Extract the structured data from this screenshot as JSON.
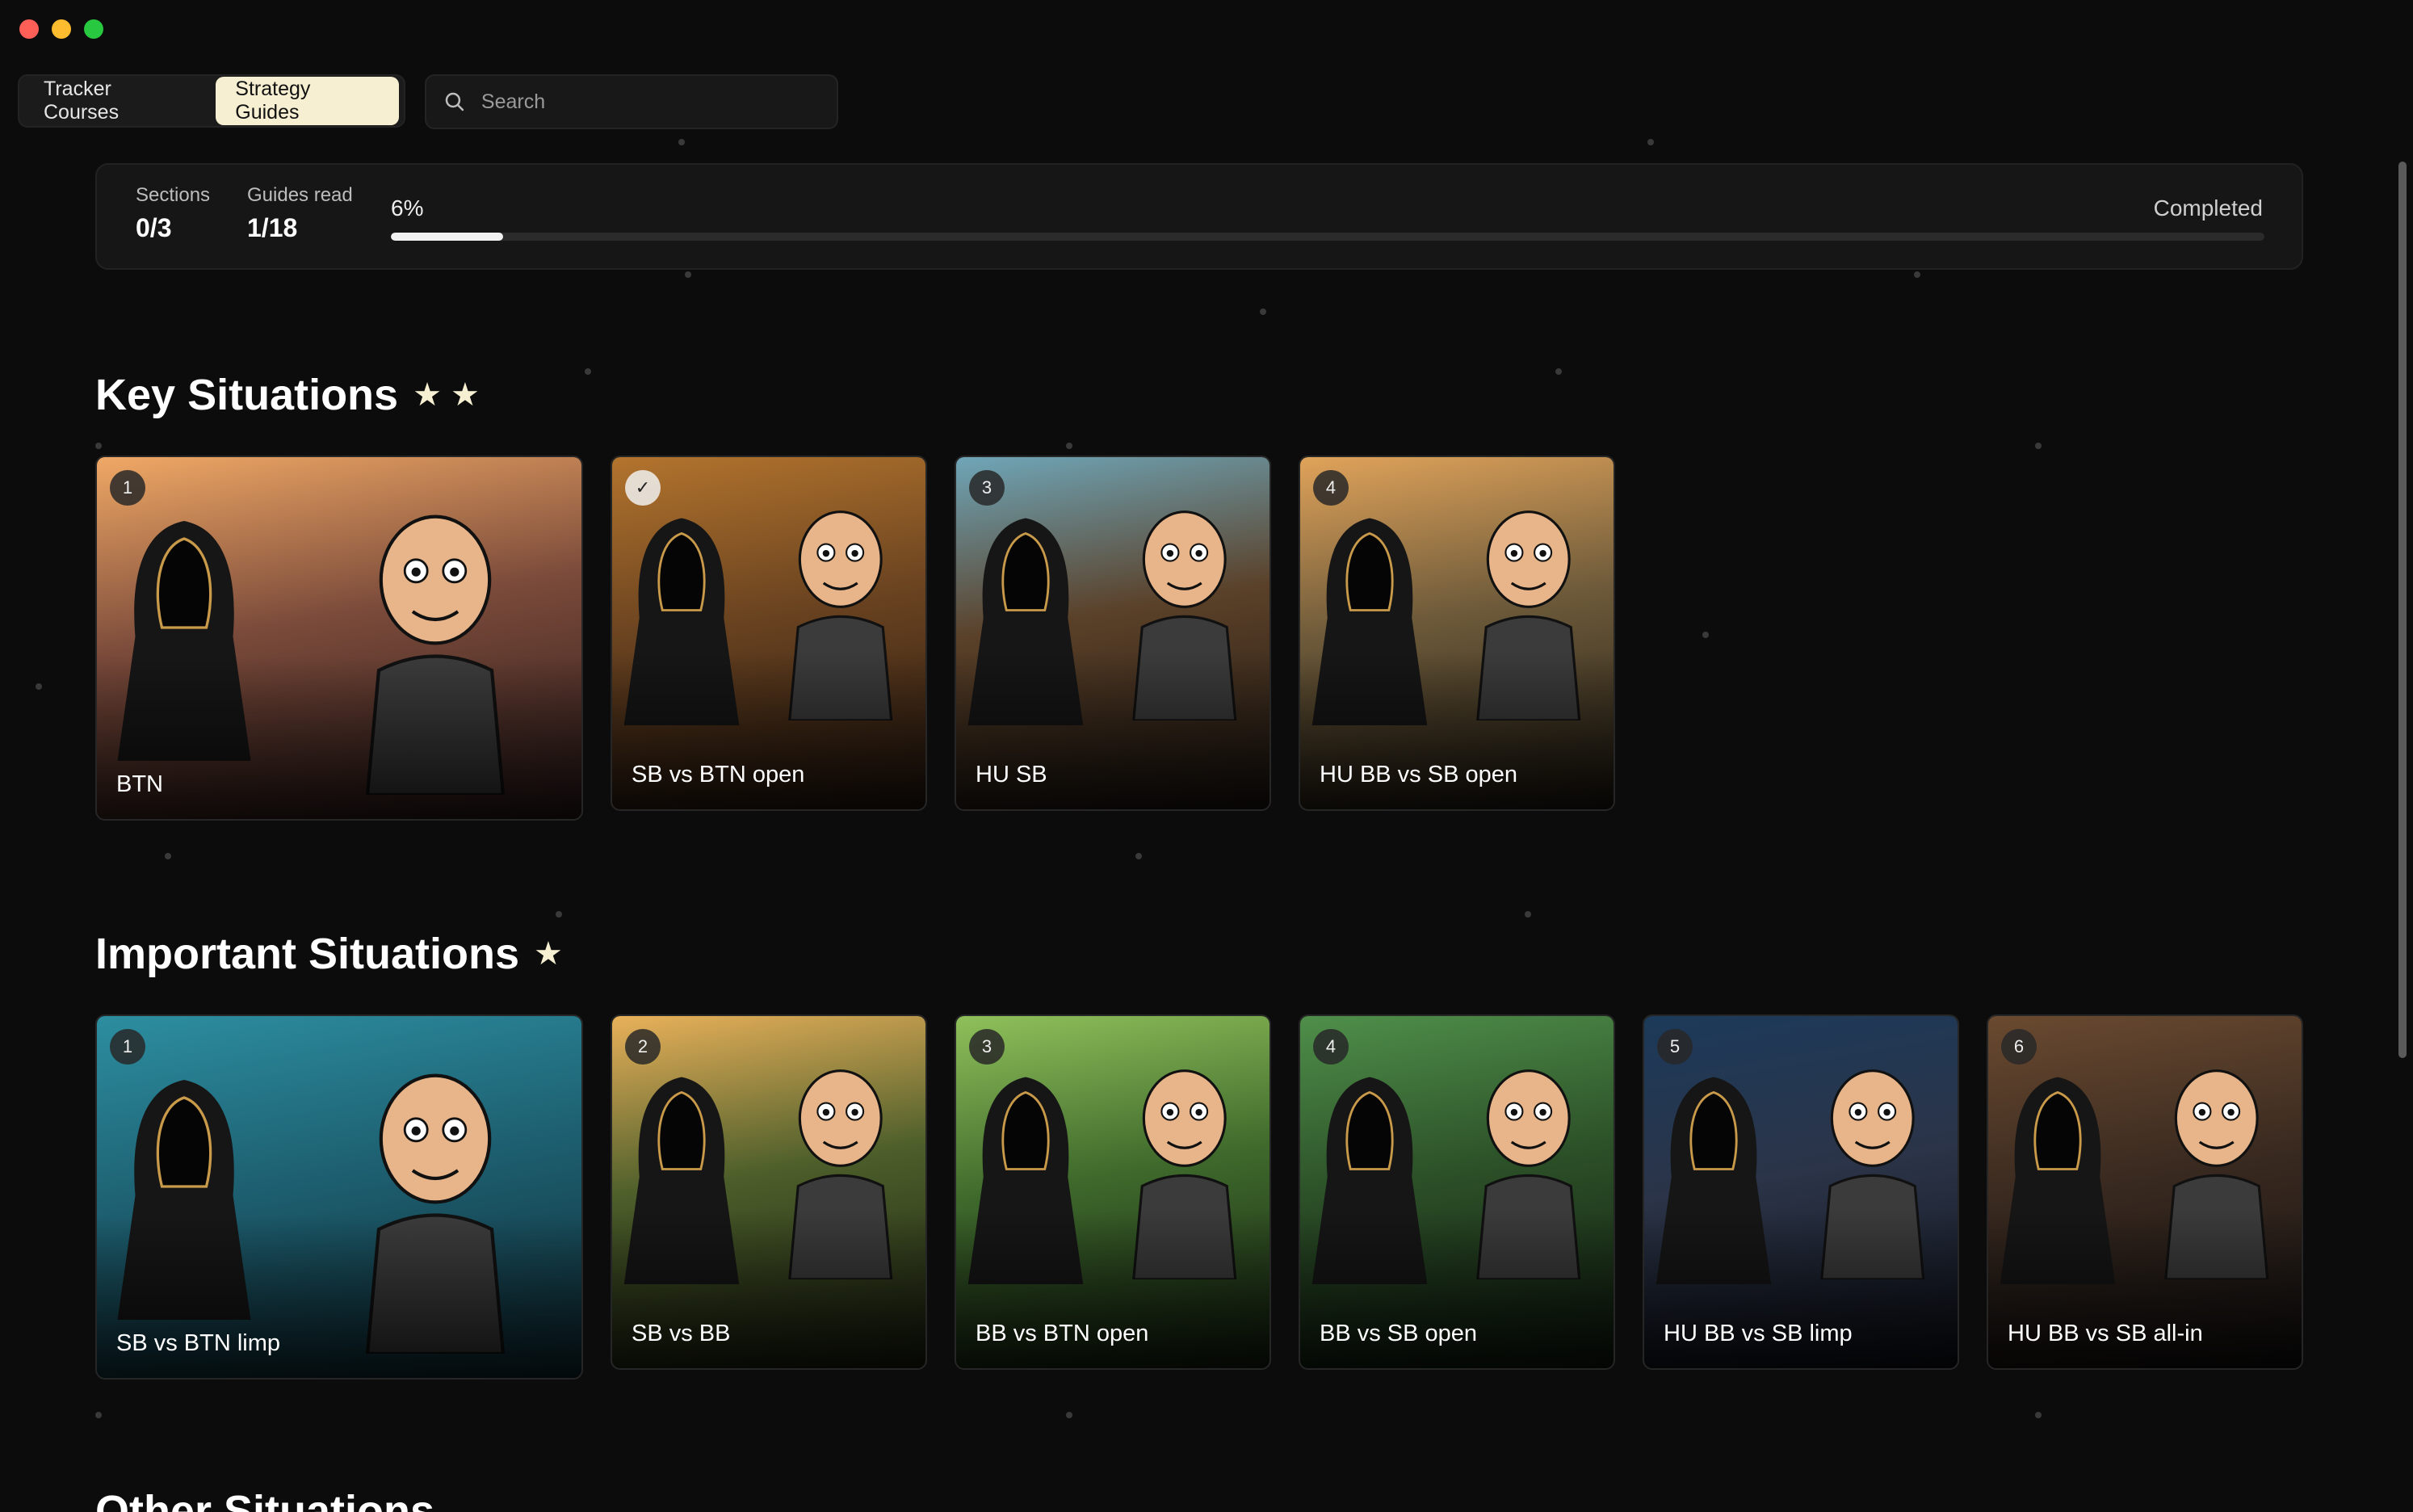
{
  "tabs": [
    {
      "label": "Tracker Courses",
      "active": false
    },
    {
      "label": "Strategy Guides",
      "active": true
    }
  ],
  "search": {
    "placeholder": "Search"
  },
  "stats": {
    "sections_label": "Sections",
    "sections_value": "0/3",
    "guides_label": "Guides read",
    "guides_value": "1/18",
    "percent_text": "6%",
    "progress": 0.06,
    "completed_label": "Completed"
  },
  "key_section": {
    "title": "Key Situations",
    "stars": "★ ★",
    "cards": [
      {
        "badge": "1",
        "title": "BTN",
        "palette": [
          "#f0a865",
          "#7a4a3a",
          "#2a1a1a"
        ]
      },
      {
        "badge": "✓",
        "title": "SB vs BTN open",
        "palette": [
          "#b3742d",
          "#6a4320",
          "#261810"
        ]
      },
      {
        "badge": "3",
        "title": "HU SB",
        "palette": [
          "#6fa6b8",
          "#5a4028",
          "#1e1712"
        ]
      },
      {
        "badge": "4",
        "title": "HU BB vs SB open",
        "palette": [
          "#e0a35a",
          "#6d5a3a",
          "#1f1a12"
        ]
      }
    ]
  },
  "important_section": {
    "title": "Important Situations",
    "stars": "★",
    "cards": [
      {
        "badge": "1",
        "title": "SB vs BTN limp",
        "palette": [
          "#2c8ea0",
          "#1d5f70",
          "#0f2a33"
        ]
      },
      {
        "badge": "2",
        "title": "SB vs BB",
        "palette": [
          "#e9b15a",
          "#4c5e2a",
          "#1a1f10"
        ]
      },
      {
        "badge": "3",
        "title": "BB vs BTN open",
        "palette": [
          "#8fc05a",
          "#3f6a2c",
          "#142010"
        ]
      },
      {
        "badge": "4",
        "title": "BB vs SB open",
        "palette": [
          "#4f8f4a",
          "#2c5028",
          "#0f1a0e"
        ]
      },
      {
        "badge": "5",
        "title": "HU BB vs SB limp",
        "palette": [
          "#1c3a5a",
          "#2b3448",
          "#0e1118"
        ]
      },
      {
        "badge": "6",
        "title": "HU BB vs SB all-in",
        "palette": [
          "#6a4a30",
          "#3a2a20",
          "#121010"
        ]
      }
    ]
  },
  "other_section": {
    "title": "Other Situations"
  }
}
